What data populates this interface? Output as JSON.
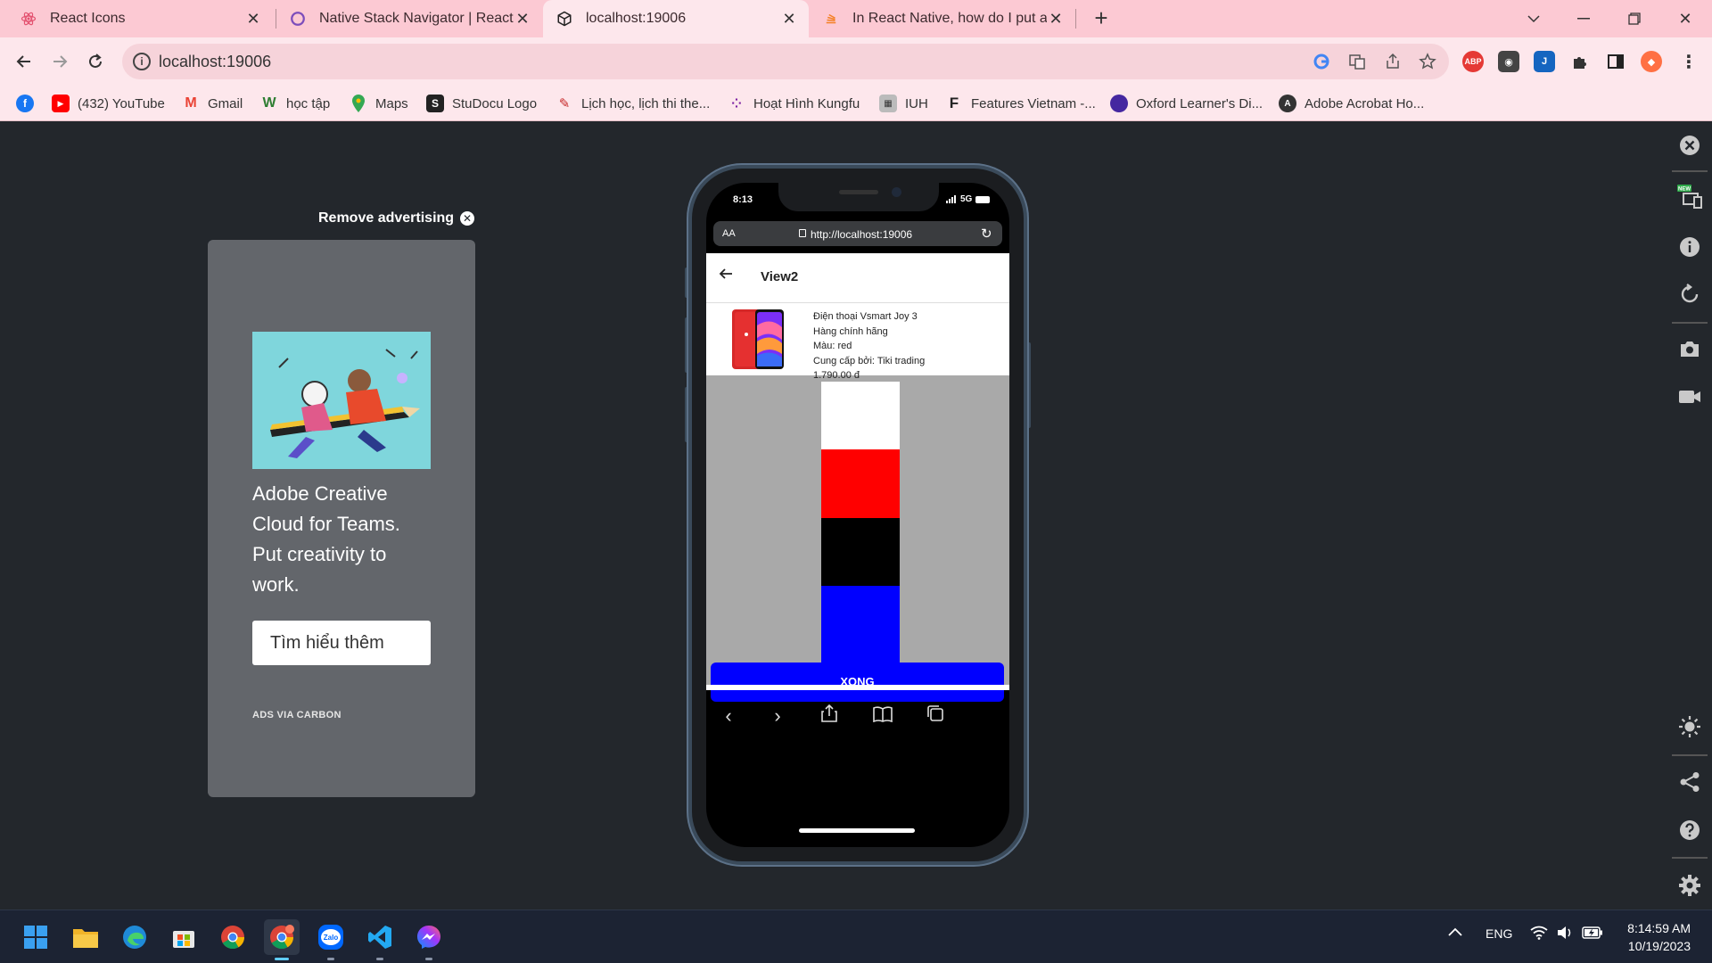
{
  "browser": {
    "tabs": [
      {
        "title": "React Icons",
        "active": false
      },
      {
        "title": "Native Stack Navigator | React N",
        "active": false
      },
      {
        "title": "localhost:19006",
        "active": true
      },
      {
        "title": "In React Native, how do I put a v",
        "active": false
      }
    ],
    "address": "localhost:19006",
    "extensions": [
      "google-icon",
      "translate-icon",
      "share-icon",
      "bookmark-star-icon",
      "ABP",
      "capture-icon",
      "j-extension-icon",
      "puzzle-icon",
      "sidepanel-icon",
      "fox-icon"
    ],
    "bookmarks": [
      {
        "label": "",
        "icon": "facebook-icon",
        "color": "#1877f2"
      },
      {
        "label": "(432) YouTube",
        "icon": "youtube-icon",
        "color": "#ff0000"
      },
      {
        "label": "Gmail",
        "icon": "gmail-icon",
        "color": "#ea4335"
      },
      {
        "label": "học tập",
        "icon": "w-icon",
        "color": "#2e7d32"
      },
      {
        "label": "Maps",
        "icon": "maps-icon",
        "color": "#34a853"
      },
      {
        "label": "StuDocu Logo",
        "icon": "studocu-icon",
        "color": "#222222"
      },
      {
        "label": "Lịch học, lịch thi the...",
        "icon": "calendar-icon",
        "color": "#c62828"
      },
      {
        "label": "Hoạt Hình Kungfu",
        "icon": "dots-icon",
        "color": "#7b1fa2"
      },
      {
        "label": "IUH",
        "icon": "iuh-icon",
        "color": "#777777"
      },
      {
        "label": "Features Vietnam -...",
        "icon": "f-icon",
        "color": "#222222"
      },
      {
        "label": "Oxford Learner's Di...",
        "icon": "oxford-icon",
        "color": "#4527a0"
      },
      {
        "label": "Adobe Acrobat Ho...",
        "icon": "acrobat-icon",
        "color": "#333333"
      }
    ]
  },
  "ad": {
    "remove_label": "Remove advertising",
    "headline": "Adobe Creative Cloud for Teams. Put creativity to work.",
    "cta": "Tìm hiểu thêm",
    "via": "ADS VIA CARBON"
  },
  "phone": {
    "time": "8:13",
    "network": "5G",
    "safari_aa": "AA",
    "safari_url": "http://localhost:19006",
    "header_title": "View2",
    "product": {
      "name": "Điện thoại Vsmart Joy 3",
      "line2": "Hàng chính hãng",
      "color_line": "Màu: red",
      "supplier": "Cung cấp bởi: Tiki trading",
      "price": "1.790.00 đ"
    },
    "swatches": [
      "#ffffff",
      "#ff0000",
      "#000000",
      "#0000ff"
    ],
    "done_label": "XONG",
    "done_color": "#0000ff"
  },
  "devtools_sidebar": [
    "close-icon",
    "device-icon",
    "info-icon",
    "rotate-icon",
    "camera-icon",
    "video-icon",
    "brightness-icon",
    "share-icon",
    "help-icon",
    "settings-icon"
  ],
  "devtools_badge": "NEW",
  "taskbar": {
    "apps": [
      "windows-start-icon",
      "file-explorer-icon",
      "edge-icon",
      "store-icon",
      "chrome-icon",
      "chrome-active-icon",
      "zalo-icon",
      "vscode-icon",
      "messenger-icon"
    ],
    "zalo_label": "Zalo",
    "language": "ENG",
    "time": "8:14:59 AM",
    "date": "10/19/2023"
  }
}
